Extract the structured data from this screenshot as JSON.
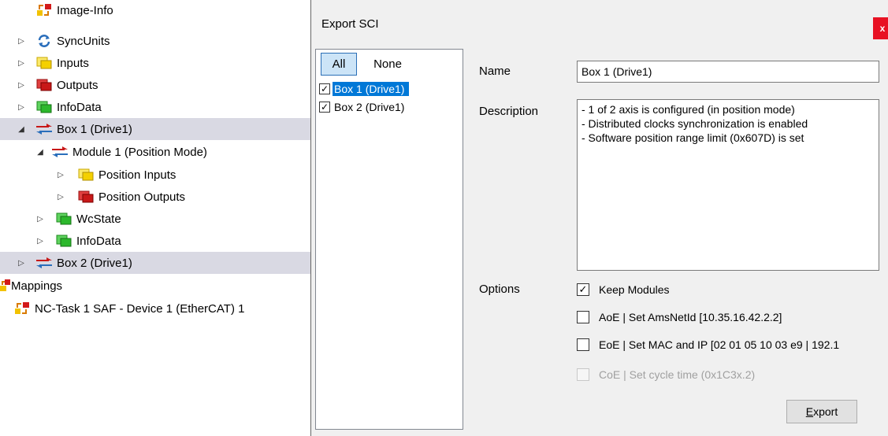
{
  "tree": {
    "items": [
      {
        "label": "Image-Info",
        "arrow": "",
        "icon": "image-info-icon"
      },
      {
        "label": "SyncUnits",
        "arrow": "▷",
        "icon": "sync-units-icon"
      },
      {
        "label": "Inputs",
        "arrow": "▷",
        "icon": "inputs-icon"
      },
      {
        "label": "Outputs",
        "arrow": "▷",
        "icon": "outputs-icon"
      },
      {
        "label": "InfoData",
        "arrow": "▷",
        "icon": "infodata-icon"
      },
      {
        "label": "Box 1 (Drive1)",
        "arrow": "◢",
        "icon": "box-icon"
      },
      {
        "label": "Module 1 (Position Mode)",
        "arrow": "◢",
        "icon": "module-icon"
      },
      {
        "label": "Position Inputs",
        "arrow": "▷",
        "icon": "inputs-icon"
      },
      {
        "label": "Position Outputs",
        "arrow": "▷",
        "icon": "outputs-icon"
      },
      {
        "label": "WcState",
        "arrow": "▷",
        "icon": "wcstate-icon"
      },
      {
        "label": "InfoData",
        "arrow": "▷",
        "icon": "infodata-icon"
      },
      {
        "label": "Box 2 (Drive1)",
        "arrow": "▷",
        "icon": "box-icon"
      },
      {
        "label": "Mappings",
        "arrow": "",
        "icon": "mappings-icon"
      },
      {
        "label": "NC-Task 1 SAF - Device 1 (EtherCAT) 1",
        "arrow": "",
        "icon": "mapping-entry-icon"
      }
    ]
  },
  "dialog": {
    "title": "Export SCI",
    "close_label": "x",
    "toggle_all": "All",
    "toggle_none": "None",
    "list": [
      {
        "label": "Box 1 (Drive1)",
        "checked": true
      },
      {
        "label": "Box 2 (Drive1)",
        "checked": true
      }
    ],
    "name_label": "Name",
    "name_value": "Box 1 (Drive1)",
    "description_label": "Description",
    "description_lines": [
      "- 1 of 2 axis is configured (in position mode)",
      "- Distributed clocks synchronization is enabled",
      "- Software position range limit (0x607D) is set"
    ],
    "options_label": "Options",
    "options": [
      {
        "label": "Keep Modules",
        "checked": true,
        "enabled": true
      },
      {
        "label": "AoE | Set AmsNetId [10.35.16.42.2.2]",
        "checked": false,
        "enabled": true
      },
      {
        "label": "EoE | Set MAC and IP [02 01 05 10 03 e9 | 192.1",
        "checked": false,
        "enabled": true
      },
      {
        "label": "CoE | Set cycle time (0x1C3x.2)",
        "checked": false,
        "enabled": false
      }
    ],
    "export_mnemonic": "E",
    "export_rest": "xport"
  },
  "colors": {
    "selection_row": "#d9d9e3",
    "list_highlight": "#0078d7",
    "close_button": "#e81123",
    "dialog_bg": "#f0f0f0"
  }
}
